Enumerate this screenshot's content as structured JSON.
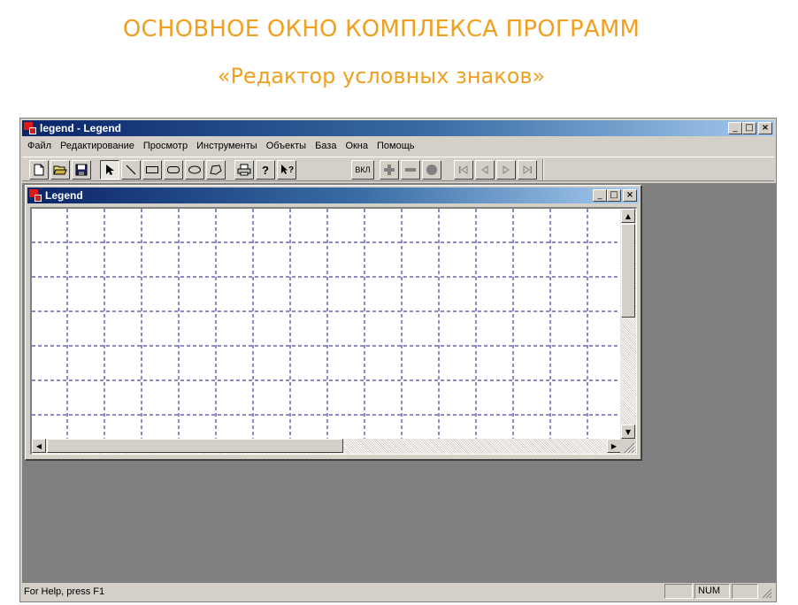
{
  "slide": {
    "title": "ОСНОВНОЕ ОКНО КОМПЛЕКСА ПРОГРАММ",
    "subtitle": "«Редактор условных знаков»"
  },
  "app": {
    "title": "legend - Legend",
    "menu": [
      "Файл",
      "Редактирование",
      "Просмотр",
      "Инструменты",
      "Объекты",
      "База",
      "Окна",
      "Помощь"
    ],
    "toolbar": {
      "on_label": "ВКЛ",
      "buttons": [
        "new-file-icon",
        "open-folder-icon",
        "save-disk-icon",
        "pointer-arrow-icon",
        "line-tool-icon",
        "rectangle-tool-icon",
        "rounded-rect-tool-icon",
        "ellipse-tool-icon",
        "polygon-tool-icon",
        "print-icon",
        "help-question-icon",
        "context-help-icon",
        "on-button",
        "plus-icon",
        "minus-icon",
        "circle-icon",
        "first-record-icon",
        "prev-record-icon",
        "next-record-icon",
        "last-record-icon"
      ]
    },
    "child_window": {
      "title": "Legend"
    },
    "status": {
      "help_text": "For Help, press F1",
      "num": "NUM"
    },
    "colors": {
      "slide_title": "#f0a020",
      "titlebar_start": "#0a246a",
      "titlebar_end": "#a6caf0",
      "grid_line": "#1a1a8a",
      "workspace": "#808080",
      "face": "#d4d0c8"
    }
  }
}
